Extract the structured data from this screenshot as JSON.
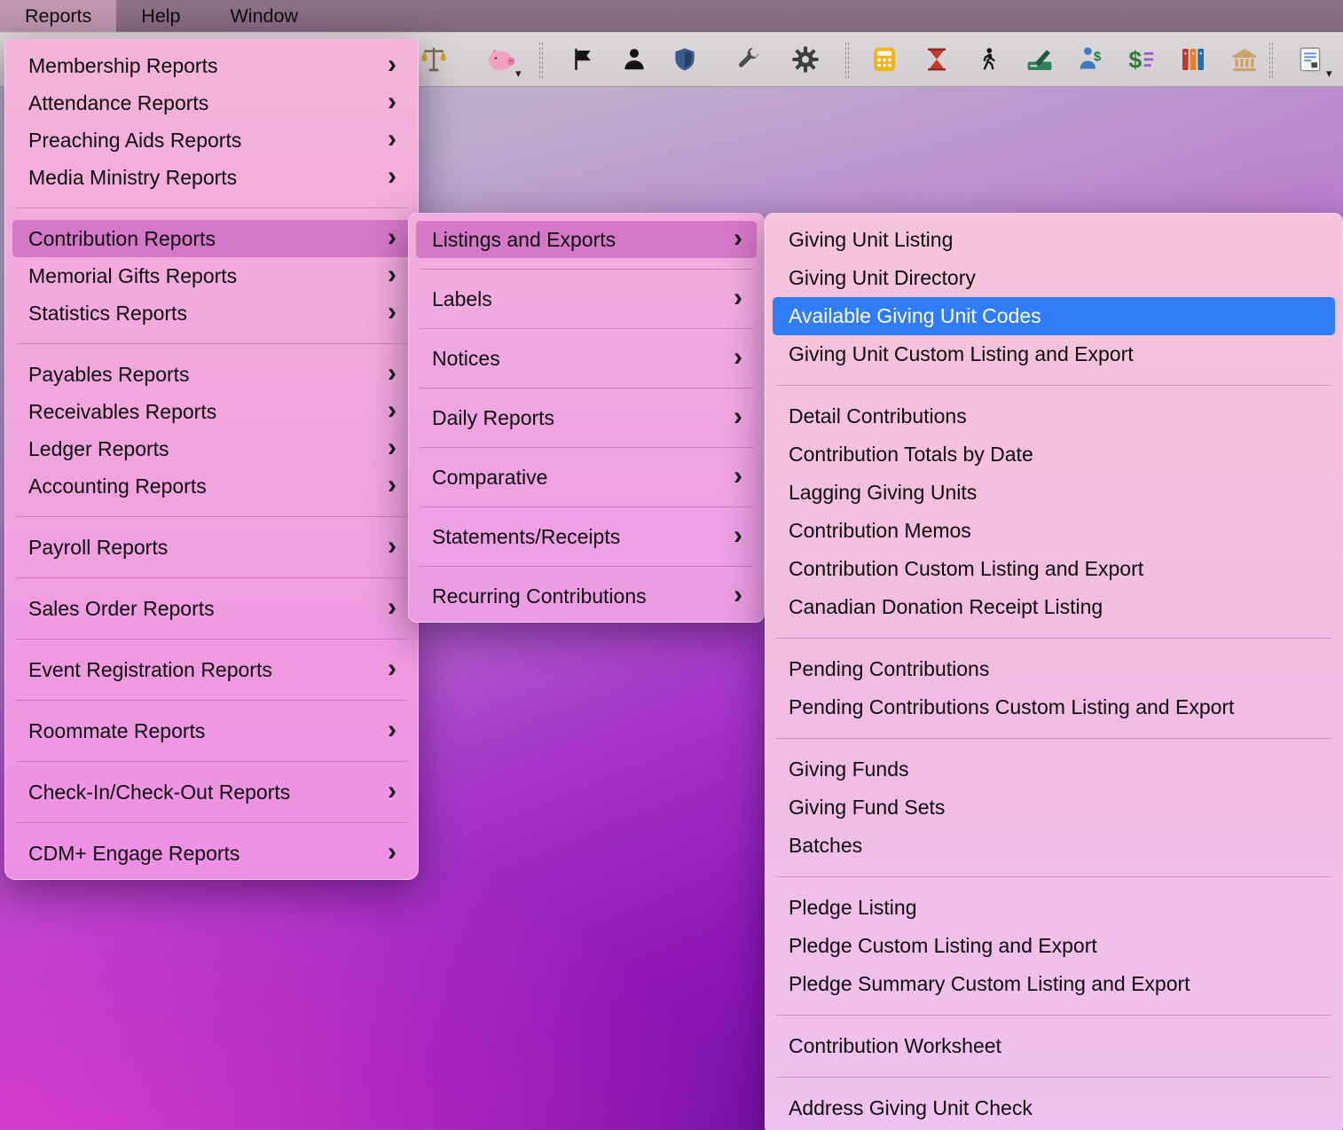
{
  "glyphs": {
    "chevron_right": "›",
    "dropdown_arrow": "▾"
  },
  "colors": {
    "selection_blue": "#2f7cf6",
    "menu_highlight_pink": "#d678c8"
  },
  "menu_bar": {
    "items": [
      {
        "label": "Reports",
        "active": true
      },
      {
        "label": "Help",
        "active": false
      },
      {
        "label": "Window",
        "active": false
      }
    ]
  },
  "toolbar": {
    "icons": [
      {
        "name": "scales-icon"
      },
      {
        "name": "piggy-bank-icon",
        "has_dropdown": true
      },
      {
        "name": "door-flag-icon"
      },
      {
        "name": "person-icon"
      },
      {
        "name": "shield-icon"
      },
      {
        "name": "wrench-icon"
      },
      {
        "name": "gear-icon"
      },
      {
        "name": "calculator-icon"
      },
      {
        "name": "hourglass-icon"
      },
      {
        "name": "walking-person-icon"
      },
      {
        "name": "signature-pad-icon"
      },
      {
        "name": "person-dollar-icon"
      },
      {
        "name": "dollar-statement-icon"
      },
      {
        "name": "binders-icon"
      },
      {
        "name": "bank-icon"
      },
      {
        "name": "report-document-icon",
        "has_dropdown": true
      }
    ]
  },
  "reports_menu": {
    "items": [
      {
        "label": "Membership Reports",
        "has_submenu": true
      },
      {
        "label": "Attendance Reports",
        "has_submenu": true
      },
      {
        "label": "Preaching Aids Reports",
        "has_submenu": true
      },
      {
        "label": "Media Ministry Reports",
        "has_submenu": true
      },
      {
        "label": "Contribution Reports",
        "has_submenu": true,
        "highlighted": true
      },
      {
        "label": "Memorial Gifts Reports",
        "has_submenu": true
      },
      {
        "label": "Statistics Reports",
        "has_submenu": true
      },
      {
        "label": "Payables Reports",
        "has_submenu": true
      },
      {
        "label": "Receivables Reports",
        "has_submenu": true
      },
      {
        "label": "Ledger Reports",
        "has_submenu": true
      },
      {
        "label": "Accounting Reports",
        "has_submenu": true
      },
      {
        "label": "Payroll Reports",
        "has_submenu": true
      },
      {
        "label": "Sales Order Reports",
        "has_submenu": true
      },
      {
        "label": "Event Registration Reports",
        "has_submenu": true
      },
      {
        "label": "Roommate Reports",
        "has_submenu": true
      },
      {
        "label": "Check-In/Check-Out Reports",
        "has_submenu": true
      },
      {
        "label": "CDM+ Engage Reports",
        "has_submenu": true
      }
    ]
  },
  "contribution_submenu": {
    "items": [
      {
        "label": "Listings and Exports",
        "has_submenu": true,
        "highlighted": true
      },
      {
        "label": "Labels",
        "has_submenu": true
      },
      {
        "label": "Notices",
        "has_submenu": true
      },
      {
        "label": "Daily Reports",
        "has_submenu": true
      },
      {
        "label": "Comparative",
        "has_submenu": true
      },
      {
        "label": "Statements/Receipts",
        "has_submenu": true
      },
      {
        "label": "Recurring Contributions",
        "has_submenu": true
      }
    ]
  },
  "listings_submenu": {
    "items": [
      {
        "label": "Giving Unit Listing"
      },
      {
        "label": "Giving Unit Directory"
      },
      {
        "label": "Available Giving Unit Codes",
        "selected": true
      },
      {
        "label": "Giving Unit Custom Listing and Export"
      },
      {
        "label": "Detail Contributions"
      },
      {
        "label": "Contribution Totals by Date"
      },
      {
        "label": "Lagging Giving Units"
      },
      {
        "label": "Contribution Memos"
      },
      {
        "label": "Contribution Custom Listing and Export"
      },
      {
        "label": "Canadian Donation Receipt Listing"
      },
      {
        "label": "Pending Contributions"
      },
      {
        "label": "Pending Contributions Custom Listing and Export"
      },
      {
        "label": "Giving Funds"
      },
      {
        "label": "Giving Fund Sets"
      },
      {
        "label": "Batches"
      },
      {
        "label": "Pledge Listing"
      },
      {
        "label": "Pledge Custom Listing and Export"
      },
      {
        "label": "Pledge Summary Custom Listing and Export"
      },
      {
        "label": "Contribution Worksheet"
      },
      {
        "label": "Address Giving Unit Check"
      }
    ]
  }
}
